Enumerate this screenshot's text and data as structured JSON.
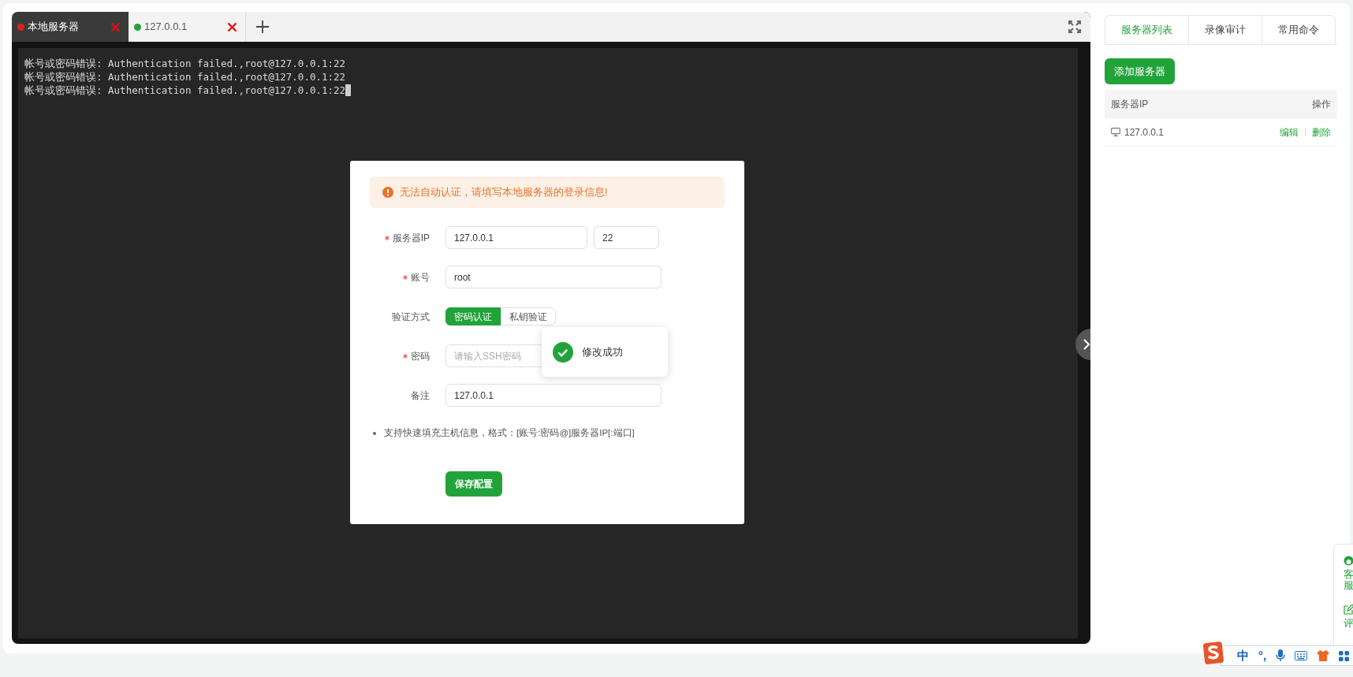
{
  "terminal_tabs": [
    {
      "label": "本地服务器",
      "color": "#e02020",
      "selected": true
    },
    {
      "label": "127.0.0.1",
      "color": "#22a33a",
      "selected": false
    }
  ],
  "terminal": {
    "lines": [
      "帐号或密码错误: Authentication failed.,root@127.0.0.1:22",
      "帐号或密码错误: Authentication failed.,root@127.0.0.1:22",
      "帐号或密码错误: Authentication failed.,root@127.0.0.1:22"
    ],
    "cursor": true
  },
  "dialog": {
    "alert": "无法自动认证，请填写本地服务器的登录信息!",
    "fields": [
      {
        "kind": "host",
        "label": "服务器IP",
        "required": true,
        "value": "127.0.0.1",
        "port": "22"
      },
      {
        "kind": "text",
        "label": "账号",
        "required": true,
        "value": "root"
      },
      {
        "kind": "segmented",
        "label": "验证方式",
        "required": false,
        "options": [
          {
            "label": "密码认证",
            "selected": true
          },
          {
            "label": "私钥验证",
            "selected": false
          }
        ]
      },
      {
        "kind": "password",
        "label": "密码",
        "required": true,
        "placeholder": "请输入SSH密码"
      },
      {
        "kind": "text",
        "label": "备注",
        "required": false,
        "value": "127.0.0.1"
      }
    ],
    "hints": [
      "支持快速填充主机信息，格式：[账号:密码@]服务器IP[:端口]"
    ],
    "save_button": "保存配置"
  },
  "toast": {
    "message": "修改成功"
  },
  "side_panel": {
    "tabs": [
      {
        "label": "服务器列表",
        "selected": true
      },
      {
        "label": "录像审计",
        "selected": false
      },
      {
        "label": "常用命令",
        "selected": false
      }
    ],
    "add_button": "添加服务器",
    "table": {
      "columns": [
        "服务器IP",
        "操作"
      ],
      "rows": [
        {
          "ip": "127.0.0.1",
          "actions": [
            "编辑",
            "删除"
          ]
        }
      ]
    }
  },
  "float_bar": [
    {
      "kind": "service",
      "label": "客服"
    },
    {
      "kind": "review",
      "label": "评"
    }
  ],
  "ime_bar": {
    "mode": "中",
    "punct": "°,"
  }
}
